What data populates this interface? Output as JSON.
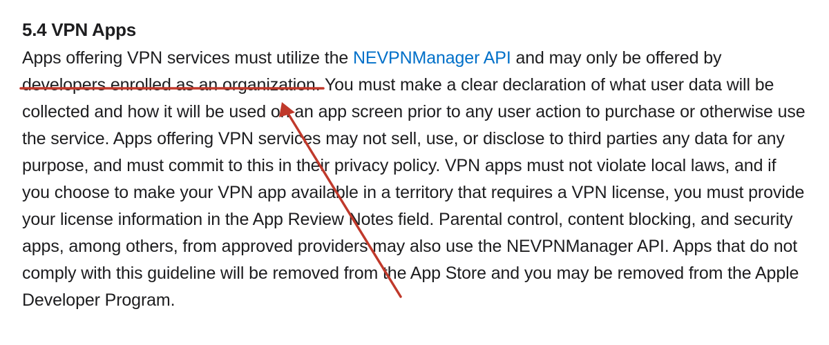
{
  "section": {
    "heading": "5.4 VPN Apps",
    "body_part1": "Apps offering VPN services must utilize the ",
    "link_text": "NEVPNManager API",
    "body_part2": " and may only be offered by developers enrolled as an organization. You must make a clear declaration of what user data will be collected and how it will be used on an app screen prior to any user action to purchase or otherwise use the service. Apps offering VPN services may not sell, use, or disclose to third parties any data for any purpose, and must commit to this in their privacy policy. VPN apps must not violate local laws, and if you choose to make your VPN app available in a territory that requires a VPN license, you must provide your license information in the App Review Notes field. Parental control, content blocking, and security apps, among others, from approved providers may also use the NEVPNManager API. Apps that do not comply with this guideline will be removed from the App Store and you may be removed from the Apple Developer Program."
  },
  "annotation": {
    "underline_color": "#C0392B",
    "arrow_color": "#C0392B",
    "highlighted_phrase": "developers enrolled as an organization."
  }
}
